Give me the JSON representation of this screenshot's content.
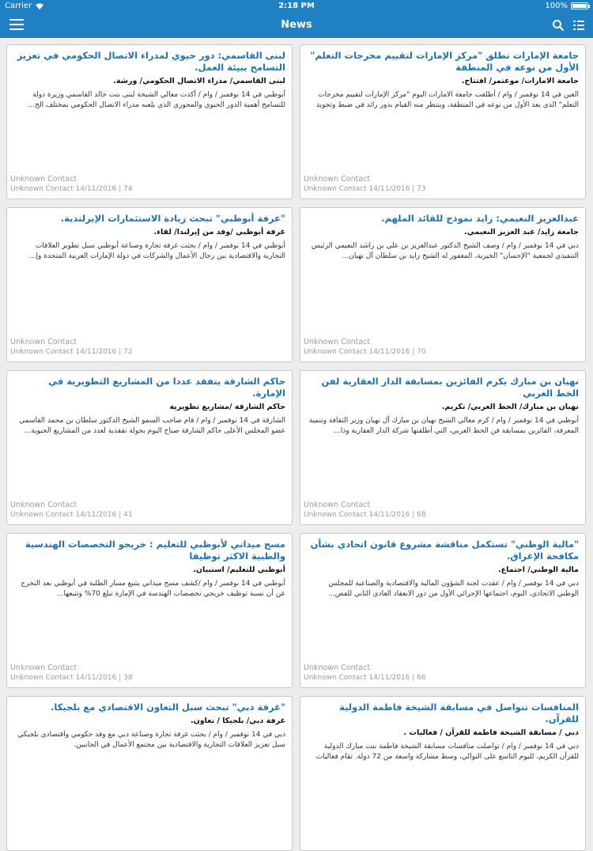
{
  "status": {
    "carrier": "Carrier",
    "time": "2:18 PM",
    "battery": "100%",
    "battery_level": 1.0
  },
  "nav": {
    "title": "News"
  },
  "cards": [
    {
      "headline": "جامعة الإمارات تطلق \"مركز الإمارات لتقييم مخرجات التعلم\" الأول من نوعه في المنطقة",
      "category": "جامعة الامارات/ موعتمر/ افتتاح.",
      "excerpt": "العين في 14 نوفمبر / وام / أطلقت جامعة الامارات اليوم \"مركز الإمارات لتقييم مخرجات التعلم\" الذي يعد الأول من نوعه في المنطقة، وينتظر منه القيام بدور رائد في ضبط وتجويد",
      "contact": "Unknown Contact",
      "meta": "Unknown Contact 14/11/2016 | 73"
    },
    {
      "headline": "لبنى القاسمي: دور حيوي لمدراء الاتصال الحكومي في تعزيز التسامح ببيئة العمل.",
      "category": "لبنى القاسمي/ مدراء الاتصال الحكومي/ ورشة.",
      "excerpt": "أبوظبي في 14 نوفمبر / وام / أكدت معالي الشيخة لبنى بنت خالد القاسمي وزيرة دولة للتسامح أهمية الدور الحيوي والمحوري الذي يلعبه مدراء الاتصال الحكومي بمختلف الج...",
      "contact": "Unknown Contact",
      "meta": "Unknown Contact 14/11/2016 | 74"
    },
    {
      "headline": "عبدالعزيز النعيمي: زايد نموذج للقائد الملهم.",
      "category": "جامعة زايد/ عبد العزيز النعيمي.",
      "excerpt": "دبي في 14 نوفمبر / وام / وصف الشيخ الدكتور عبدالعزيز بن علي بن راشد النعيمي الرئيس التنفيذي لجمعية \"الإحسان\" الخيرية، المغفور له الشيخ زايد بن سلطان آل نهيان...",
      "contact": "Unknown Contact",
      "meta": "Unknown Contact 14/11/2016 | 70"
    },
    {
      "headline": "\"غرفة أبوظبي\" تبحث زيادة الاستثمارات الإيرلندية.",
      "category": "غرفة أبوظبي /وفد من إيرلندا/ لقاء.",
      "excerpt": "أبوظبي في 14 نوفمبر / وام / بحثت غرفة تجارة وصناعة أبوظبي سبل تطوير العلاقات التجارية والاقتصادية بين رجال الأعمال والشركات في دولة الإمارات العربية المتحدة وإ...",
      "contact": "Unknown Contact",
      "meta": "Unknown Contact 14/11/2016 | 72"
    },
    {
      "headline": "نهيان بن مبارك يكرم الفائزين بمسابقة الدار العقارية لفن الخط العربي",
      "category": "نهيان بن مبارك/ الخط العربي/ تكريم.",
      "excerpt": "أبوظبي في 14 نوفمبر / وام / كرم معالي الشيخ نهيان بن مبارك آل نهيان وزير الثقافة وتنمية المعرفة، الفائزين بمسابقة فن الخط العربي، التي أطلقتها شركة الدار العقارية وذا...",
      "contact": "Unknown Contact",
      "meta": "Unknown Contact 14/11/2016 | 68"
    },
    {
      "headline": "حاكم الشارقة يتفقد عددا من المشاريع التطويرية في الإمارة.",
      "category": "حاكم الشارقة /مشاريع تطويرية",
      "excerpt": "الشارقة في 14 نوفمبر / وام / قام صاحب السمو الشيخ الدكتور سلطان بن محمد القاسمي عضو المجلس الأعلى حاكم الشارقة صباح اليوم بجولة تفقدية لعدد من المشاريع الحيوية...",
      "contact": "Unknown Contact",
      "meta": "Unknown Contact 14/11/2016 | 41"
    },
    {
      "headline": "\"مالية الوطني\" تستكمل مناقشة مشروع قانون اتحادي بشأن مكافحة الإغراق.",
      "category": "مالية الوطني/ اجتماع.",
      "excerpt": "دبي في 14 نوفمبر / وام / عقدت لجنة الشؤون المالية والاقتصادية والصناعية للمجلس الوطني الاتحادي، اليوم، اجتماعها الإجرائي الأول من دور الانعقاد العادي الثاني للفص...",
      "contact": "Unknown Contact",
      "meta": "Unknown Contact 14/11/2016 | 66"
    },
    {
      "headline": "مسح ميداني لأبوظبي للتعليم : خريجو التخصصات الهندسية والطبية الاكثر توظيفا",
      "category": "أبوظبي للتعليم/ استبيان.",
      "excerpt": "أبوظبي في 14 نوفمبر / وام /كشف مسح ميداني يتتبع مسار الطلبة في أبوظبي بعد التخرج عن أن نسبة توظيف خريجي تخصصات الهندسة في الإمارة تبلغ 70% وتتبعها...",
      "contact": "Unknown Contact",
      "meta": "Unknown Contact 14/11/2016 | 38"
    },
    {
      "headline": "المنافسات تتواصل في مسابقة الشيخة فاطمة الدولية للقرآن.",
      "category": "دبي / مسابقة الشيخة فاطمة للقرآن / فعاليات .",
      "excerpt": "دبي في 14 نوفمبر / وام / تواصلت منافسات مسابقة الشيخة فاطمة بنت مبارك الدولية للقرآن الكريم، لليوم التاسع على التوالي، وسط مشاركة واسعة من 72 دولة. تقام فعاليات",
      "contact": "",
      "meta": ""
    },
    {
      "headline": "\"غرفة دبي\" تبحث سبل التعاون الاقتصادي مع بلجيكا.",
      "category": "غرفة دبي/ بلجيكا / تعاون.",
      "excerpt": "دبي في 14 نوفمبر / وام / بحثت غرفة تجارة وصناعة دبي مع وفد حكومي واقتصادي بلجيكي سبل تعزيز العلاقات التجارية والاقتصادية بين مجتمع الأعمال في الجانبين.",
      "contact": "",
      "meta": ""
    }
  ]
}
